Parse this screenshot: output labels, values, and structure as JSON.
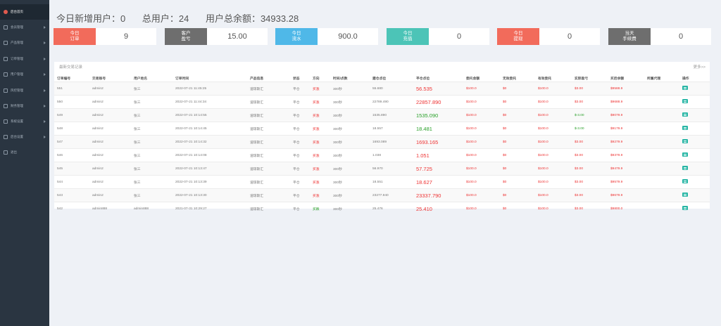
{
  "sidebar": {
    "items": [
      {
        "label": "后台首页",
        "active": true
      },
      {
        "label": "会员管理"
      },
      {
        "label": "产品管理"
      },
      {
        "label": "订单管理"
      },
      {
        "label": "用户管理"
      },
      {
        "label": "风控管理"
      },
      {
        "label": "财务管理"
      },
      {
        "label": "系统设置"
      },
      {
        "label": "后台设置"
      },
      {
        "label": "退出"
      }
    ]
  },
  "summary": {
    "new_users": "今日新增用户：0",
    "total_users": "总用户：24",
    "total_balance": "用户总余额：34933.28"
  },
  "cards": [
    {
      "label_1": "今日",
      "label_2": "订单",
      "value": "9",
      "color": "#f26b5b"
    },
    {
      "label_1": "客户",
      "label_2": "盈亏",
      "value": "15.00",
      "color": "#6e6e6e"
    },
    {
      "label_1": "今日",
      "label_2": "流水",
      "value": "900.0",
      "color": "#4fb8e8"
    },
    {
      "label_1": "今日",
      "label_2": "充值",
      "value": "0",
      "color": "#4cc4b7"
    },
    {
      "label_1": "今日",
      "label_2": "提现",
      "value": "0",
      "color": "#f26b5b"
    },
    {
      "label_1": "当天",
      "label_2": "手续费",
      "value": "0",
      "color": "#6e6e6e"
    }
  ],
  "panel": {
    "title": "最新交易记录",
    "more": "更多>>"
  },
  "table": {
    "headers": [
      "订单编号",
      "交易账号",
      "用户姓名",
      "订单时间",
      "产品信息",
      "状态",
      "方向",
      "时间/点数",
      "建仓点位",
      "平仓点位",
      "委托金额",
      "无效委托",
      "有效委托",
      "实际盈亏",
      "买后余额",
      "所属代理",
      "操作"
    ],
    "rows": [
      [
        "551",
        "admin2",
        "张三",
        "2022-07-21 11:45:25",
        "道琼斯汇",
        "平仓",
        "买涨",
        "300秒",
        "55.680",
        "56.535",
        "$100.0",
        "$0",
        "$100.0",
        "$3.00",
        "$9588.9"
      ],
      [
        "550",
        "admin2",
        "张三",
        "2022-07-21 11:44:34",
        "道琼斯汇",
        "平仓",
        "买涨",
        "300秒",
        "22789.490",
        "22857.890",
        "$100.0",
        "$0",
        "$100.0",
        "$3.00",
        "$9688.9"
      ],
      [
        "549",
        "admin2",
        "张三",
        "2022-07-21 10:14:55",
        "道琼斯汇",
        "平仓",
        "买涨",
        "300秒",
        "1535.890",
        "1535.090",
        "$100.0",
        "$0",
        "$100.0",
        "$-3.00",
        "$9079.9"
      ],
      [
        "548",
        "admin2",
        "张三",
        "2022-07-21 10:14:45",
        "道琼斯汇",
        "平仓",
        "买涨",
        "300秒",
        "18.557",
        "18.481",
        "$100.0",
        "$0",
        "$100.0",
        "$-3.00",
        "$9179.9"
      ],
      [
        "547",
        "admin2",
        "张三",
        "2022-07-21 10:14:32",
        "道琼斯汇",
        "平仓",
        "买涨",
        "300秒",
        "1693.089",
        "1693.165",
        "$100.0",
        "$0",
        "$100.0",
        "$3.00",
        "$9279.9"
      ],
      [
        "546",
        "admin2",
        "张三",
        "2022-07-21 10:14:08",
        "道琼斯汇",
        "平仓",
        "买涨",
        "300秒",
        "1.038",
        "1.051",
        "$100.0",
        "$0",
        "$100.0",
        "$3.00",
        "$9379.9"
      ],
      [
        "545",
        "admin2",
        "张三",
        "2022-07-21 10:13:47",
        "道琼斯汇",
        "平仓",
        "买涨",
        "300秒",
        "56.970",
        "57.725",
        "$100.0",
        "$0",
        "$100.0",
        "$3.00",
        "$9479.9"
      ],
      [
        "544",
        "admin2",
        "张三",
        "2022-07-21 10:13:39",
        "道琼斯汇",
        "平仓",
        "买涨",
        "300秒",
        "18.551",
        "18.627",
        "$100.0",
        "$0",
        "$100.0",
        "$3.00",
        "$9579.9"
      ],
      [
        "543",
        "admin2",
        "张三",
        "2022-07-21 10:13:30",
        "道琼斯汇",
        "平仓",
        "买涨",
        "300秒",
        "23277.940",
        "23337.790",
        "$100.0",
        "$0",
        "$100.0",
        "$3.00",
        "$9679.9"
      ],
      [
        "542",
        "admin888",
        "admin888",
        "2021-07-31 10:29:27",
        "道琼斯汇",
        "平仓",
        "买跌",
        "300秒",
        "25.476",
        "25.410",
        "$100.0",
        "$0",
        "$100.0",
        "$3.00",
        "$9800.0"
      ]
    ],
    "row_pnl_positive": [
      true,
      true,
      false,
      false,
      true,
      true,
      true,
      true,
      true,
      true
    ],
    "row_dir_up": [
      true,
      true,
      true,
      true,
      true,
      true,
      true,
      true,
      true,
      false
    ]
  }
}
